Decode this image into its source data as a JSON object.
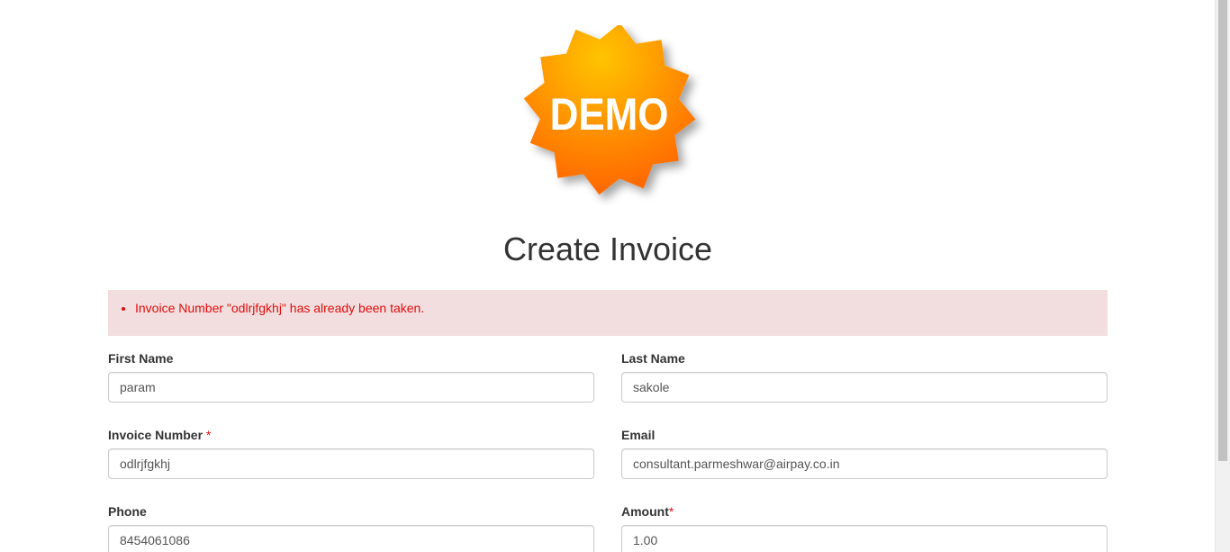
{
  "logo": {
    "text": "DEMO",
    "colors": {
      "light": "#ffc107",
      "dark": "#ff6a00",
      "text": "#ffffff"
    }
  },
  "page_title": "Create Invoice",
  "alert": {
    "messages": [
      "Invoice Number \"odlrjfgkhj\" has already been taken."
    ],
    "background": "#f2dede",
    "text_color": "#e30d0d"
  },
  "form": {
    "first_name": {
      "label": "First Name",
      "value": "param",
      "required": false
    },
    "last_name": {
      "label": "Last Name",
      "value": "sakole",
      "required": false
    },
    "invoice_number": {
      "label": "Invoice Number",
      "required_mark": "*",
      "value": "odlrjfgkhj"
    },
    "email": {
      "label": "Email",
      "value": "consultant.parmeshwar@airpay.co.in",
      "required": false
    },
    "phone": {
      "label": "Phone",
      "value": "8454061086",
      "required": false
    },
    "amount": {
      "label": "Amount",
      "required_mark": "*",
      "value": "1.00"
    }
  }
}
